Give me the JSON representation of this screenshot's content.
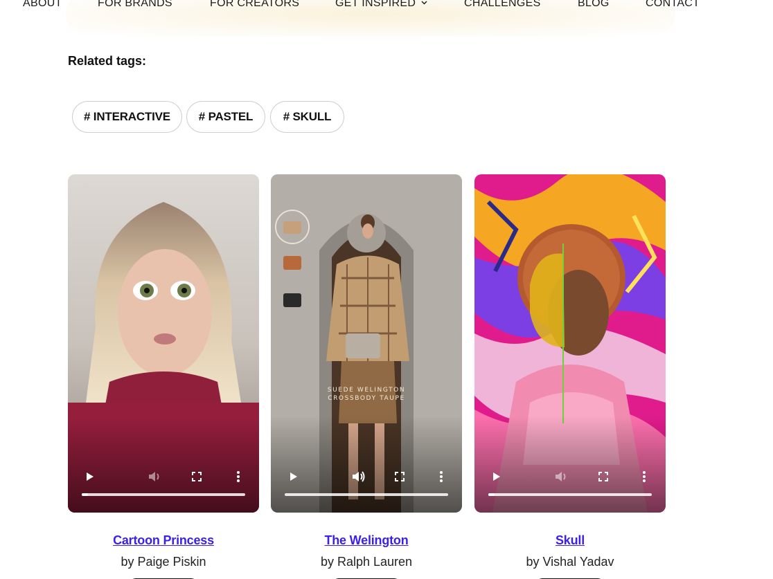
{
  "nav": {
    "items": [
      {
        "label": "ABOUT"
      },
      {
        "label": "FOR BRANDS"
      },
      {
        "label": "FOR CREATORS"
      },
      {
        "label": "GET INSPIRED"
      },
      {
        "label": "CHALLENGES"
      },
      {
        "label": "BLOG"
      },
      {
        "label": "CONTACT"
      }
    ]
  },
  "related": {
    "label": "Related tags:",
    "tags": [
      "# INTERACTIVE",
      "# PASTEL",
      "# SKULL"
    ]
  },
  "cards": [
    {
      "title": "Cartoon Princess",
      "author": "by Paige Piskin",
      "progress": 0.04,
      "muted": true
    },
    {
      "title": "The Welington",
      "author": "by Ralph Lauren",
      "progress": 0.0,
      "muted": false,
      "overlay_text_1": "SUEDE WELINGTON",
      "overlay_text_2": "CROSSBODY TAUPE"
    },
    {
      "title": "Skull",
      "author": "by Vishal Yadav",
      "progress": 0.04,
      "muted": true
    }
  ],
  "icons": {
    "play": "play-icon",
    "volume": "volume-icon",
    "fullscreen": "fullscreen-icon",
    "more": "more-vertical-icon",
    "chevron": "chevron-down-icon"
  },
  "colors": {
    "title_link": "#3b1ef0",
    "tag_border": "#cfcfcf"
  }
}
